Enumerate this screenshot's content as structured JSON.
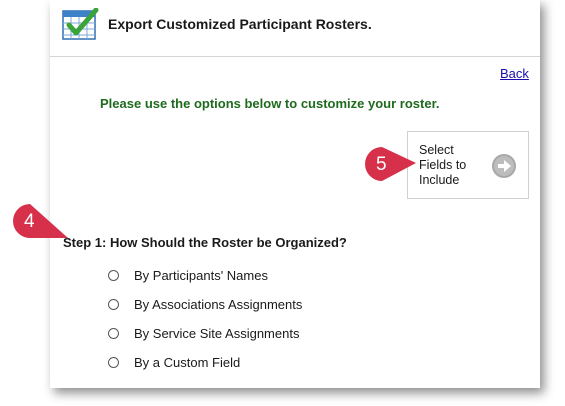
{
  "header": {
    "title": "Export Customized Participant Rosters."
  },
  "nav": {
    "back_label": "Back"
  },
  "instructions": "Please use the options below to customize your roster.",
  "select_fields": {
    "label": "Select Fields to Include"
  },
  "callouts": [
    "5",
    "4"
  ],
  "step1": {
    "heading": "Step 1: How Should the Roster be Organized?",
    "options": [
      "By Participants' Names",
      "By Associations Assignments",
      "By Service Site Assignments",
      "By a Custom Field"
    ]
  },
  "colors": {
    "instructions_text": "#1e6b1e",
    "link": "#1a0dab",
    "callout_fill": "#d6304a",
    "icon_check": "#3aa33a"
  },
  "icons": {
    "header": "spreadsheet-check-icon",
    "select_fields": "arrow-right-circle-icon"
  }
}
